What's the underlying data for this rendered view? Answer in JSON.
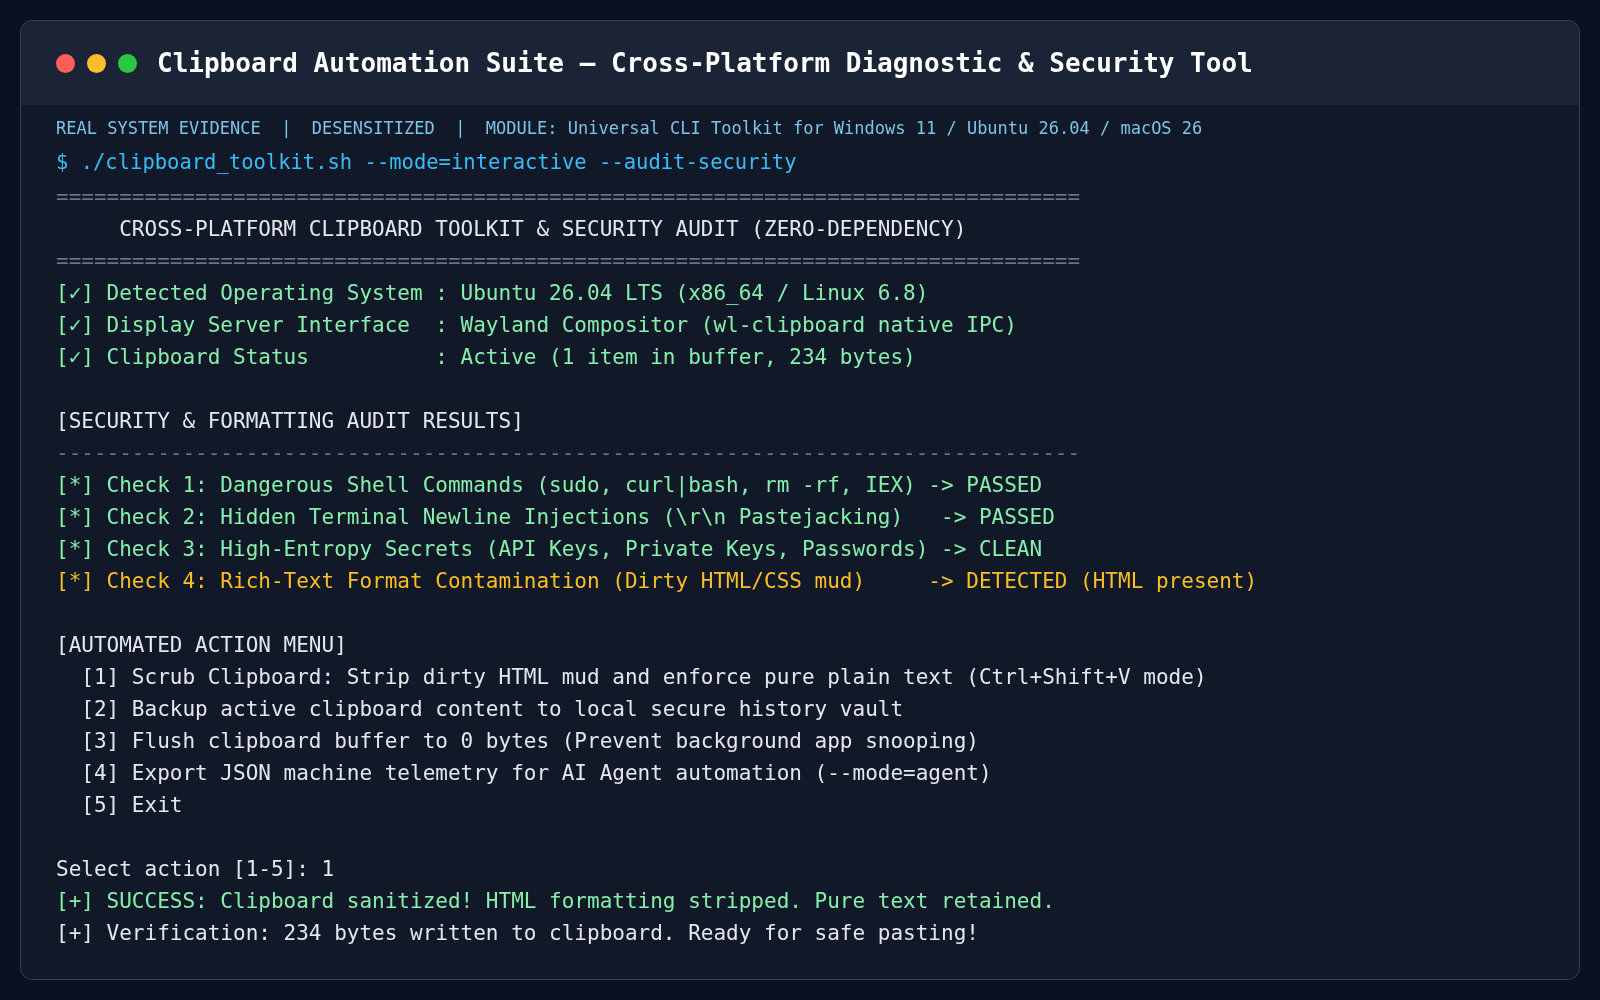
{
  "window": {
    "title": "Clipboard Automation Suite — Cross-Platform Diagnostic & Security Tool",
    "controls": [
      {
        "color": "#ff5f57"
      },
      {
        "color": "#febc2e"
      },
      {
        "color": "#28c840"
      }
    ]
  },
  "meta_line": "REAL SYSTEM EVIDENCE  |  DESENSITIZED  |  MODULE: Universal CLI Toolkit for Windows 11 / Ubuntu 26.04 / macOS 26",
  "command": "$ ./clipboard_toolkit.sh --mode=interactive --audit-security",
  "lines": [
    {
      "kind": "rule",
      "text": "================================================================================="
    },
    {
      "kind": "heading",
      "text": "     CROSS-PLATFORM CLIPBOARD TOOLKIT & SECURITY AUDIT (ZERO-DEPENDENCY)"
    },
    {
      "kind": "rule",
      "text": "================================================================================="
    },
    {
      "kind": "ok",
      "text": "[✓] Detected Operating System : Ubuntu 26.04 LTS (x86_64 / Linux 6.8)"
    },
    {
      "kind": "ok",
      "text": "[✓] Display Server Interface  : Wayland Compositor (wl-clipboard native IPC)"
    },
    {
      "kind": "ok",
      "text": "[✓] Clipboard Status          : Active (1 item in buffer, 234 bytes)"
    },
    {
      "kind": "blank"
    },
    {
      "kind": "heading",
      "text": "[SECURITY & FORMATTING AUDIT RESULTS]"
    },
    {
      "kind": "rule",
      "text": "---------------------------------------------------------------------------------"
    },
    {
      "kind": "ok",
      "text": "[*] Check 1: Dangerous Shell Commands (sudo, curl|bash, rm -rf, IEX) -> PASSED"
    },
    {
      "kind": "ok",
      "text": "[*] Check 2: Hidden Terminal Newline Injections (\\r\\n Pastejacking)   -> PASSED"
    },
    {
      "kind": "ok",
      "text": "[*] Check 3: High-Entropy Secrets (API Keys, Private Keys, Passwords) -> CLEAN"
    },
    {
      "kind": "warn",
      "text": "[*] Check 4: Rich-Text Format Contamination (Dirty HTML/CSS mud)     -> DETECTED (HTML present)"
    },
    {
      "kind": "blank"
    },
    {
      "kind": "heading",
      "text": "[AUTOMATED ACTION MENU]"
    },
    {
      "kind": "plain",
      "text": "  [1] Scrub Clipboard: Strip dirty HTML mud and enforce pure plain text (Ctrl+Shift+V mode)"
    },
    {
      "kind": "plain",
      "text": "  [2] Backup active clipboard content to local secure history vault"
    },
    {
      "kind": "plain",
      "text": "  [3] Flush clipboard buffer to 0 bytes (Prevent background app snooping)"
    },
    {
      "kind": "plain",
      "text": "  [4] Export JSON machine telemetry for AI Agent automation (--mode=agent)"
    },
    {
      "kind": "plain",
      "text": "  [5] Exit"
    },
    {
      "kind": "blank"
    },
    {
      "kind": "plain",
      "text": "Select action [1-5]: 1"
    },
    {
      "kind": "ok",
      "text": "[+] SUCCESS: Clipboard sanitized! HTML formatting stripped. Pure text retained."
    },
    {
      "kind": "plain",
      "text": "[+] Verification: 234 bytes written to clipboard. Ready for safe pasting!"
    }
  ]
}
